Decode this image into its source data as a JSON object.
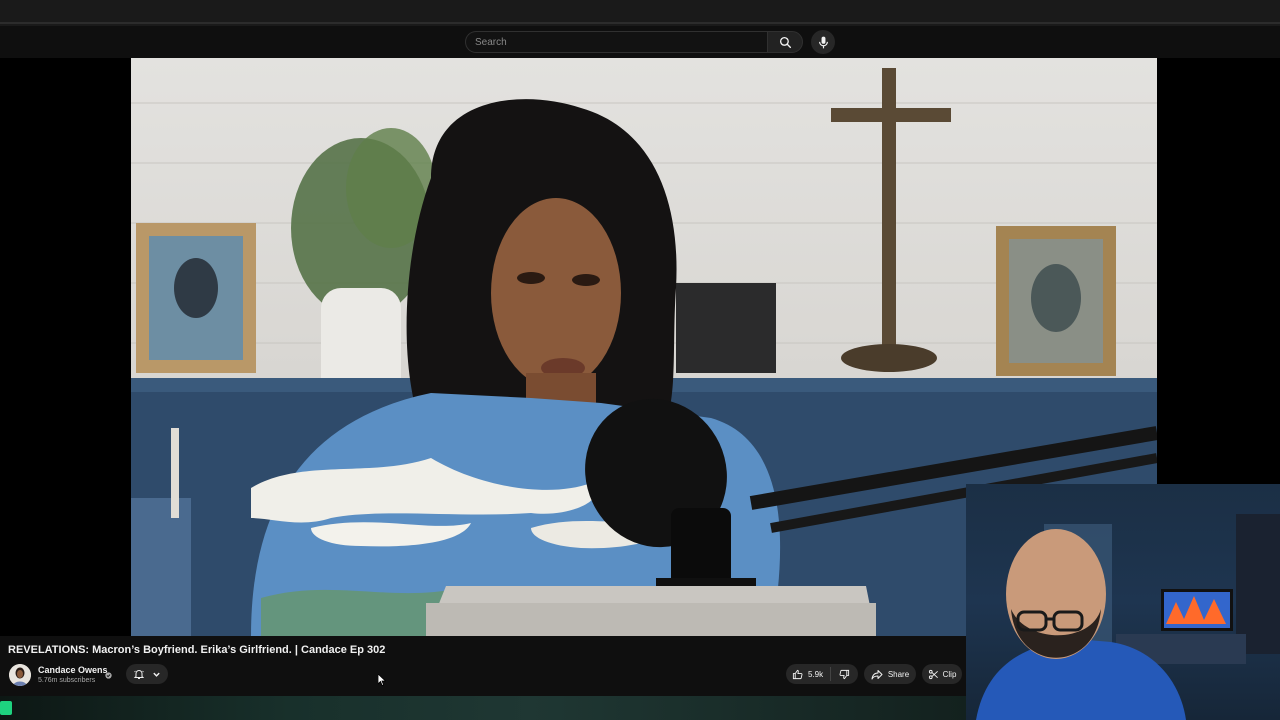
{
  "header": {
    "search_placeholder": "Search",
    "search_icon": "search-icon",
    "mic_icon": "microphone-icon"
  },
  "video": {
    "title": "REVELATIONS: Macron’s Boyfriend. Erika’s Girlfriend. | Candace Ep 302",
    "channel_name": "Candace Owens",
    "subscribers": "5.76m subscribers",
    "likes": "5.9k",
    "share_label": "Share",
    "clip_label": "Clip"
  },
  "colors": {
    "background": "#0f0f0f",
    "pill": "#272727",
    "accent_green": "#1ed27f"
  }
}
